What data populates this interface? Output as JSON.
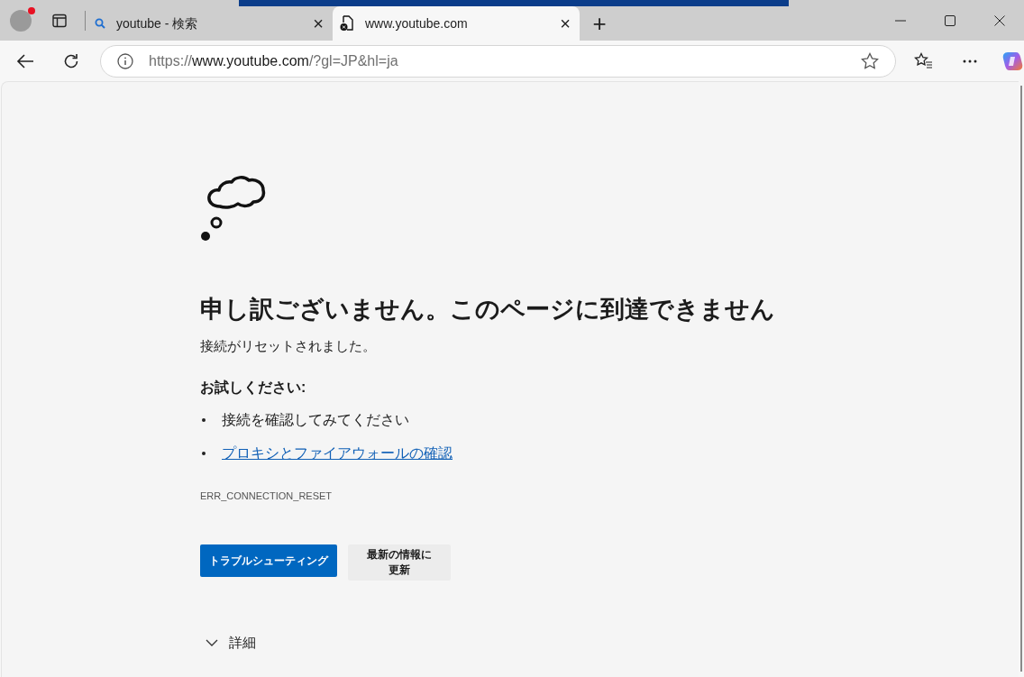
{
  "tabs": [
    {
      "kind": "search",
      "title": "youtube - 検索",
      "close": "×",
      "selected": false
    },
    {
      "kind": "error",
      "title": "www.youtube.com",
      "close": "×",
      "selected": true
    }
  ],
  "new_tab": "+",
  "address_bar": {
    "scheme": "https://",
    "host": "www.youtube.com",
    "path": "/?gl=JP&hl=ja"
  },
  "error_page": {
    "heading": "申し訳ございません。このページに到達できません",
    "message": "接続がリセットされました。",
    "suggestions_title": "お試しください:",
    "suggestions": [
      {
        "kind": "text",
        "text": "接続を確認してみてください"
      },
      {
        "kind": "link",
        "text": "プロキシとファイアウォールの確認"
      }
    ],
    "error_code": "ERR_CONNECTION_RESET",
    "buttons": [
      {
        "kind": "primary",
        "label": "トラブルシューティング"
      },
      {
        "kind": "secondary",
        "label": "最新の情報に更新"
      }
    ],
    "details": {
      "label": "詳細",
      "expanded": false
    }
  }
}
